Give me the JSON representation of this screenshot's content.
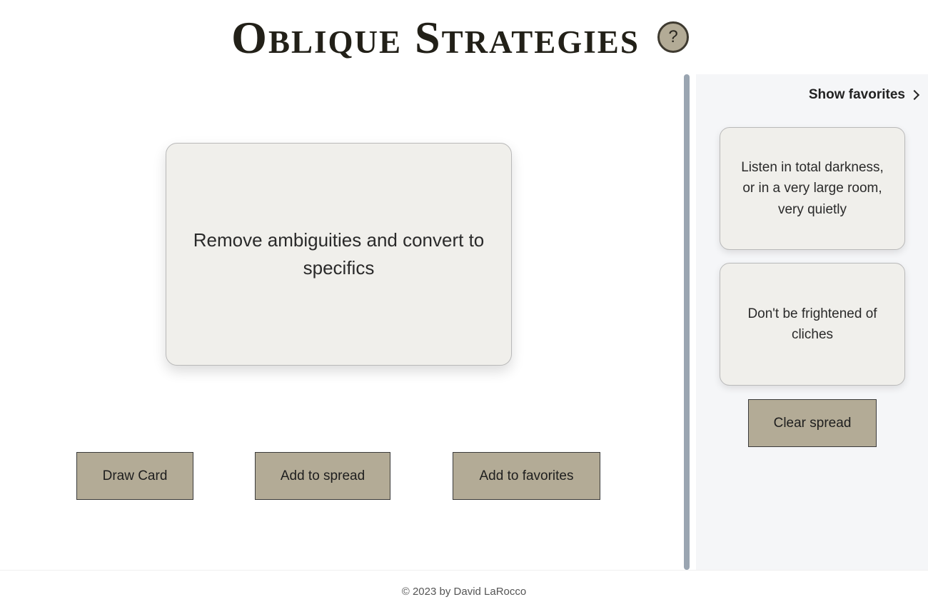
{
  "header": {
    "title": "Oblique Strategies",
    "help_label": "?"
  },
  "main": {
    "current_card": "Remove ambiguities and convert to specifics",
    "buttons": {
      "draw": "Draw Card",
      "add_spread": "Add to spread",
      "add_favorites": "Add to favorites"
    }
  },
  "sidebar": {
    "show_favorites_label": "Show favorites",
    "spread_cards": [
      "Listen in total darkness, or in a very large room, very quietly",
      "Don't be frightened of cliches"
    ],
    "clear_label": "Clear spread"
  },
  "footer": {
    "copyright": "© 2023 by David LaRocco"
  },
  "colors": {
    "button_bg": "#b3ab96",
    "card_bg": "#f0efeb",
    "divider": "#9aa5b1",
    "sidebar_bg": "#f5f6f8"
  }
}
